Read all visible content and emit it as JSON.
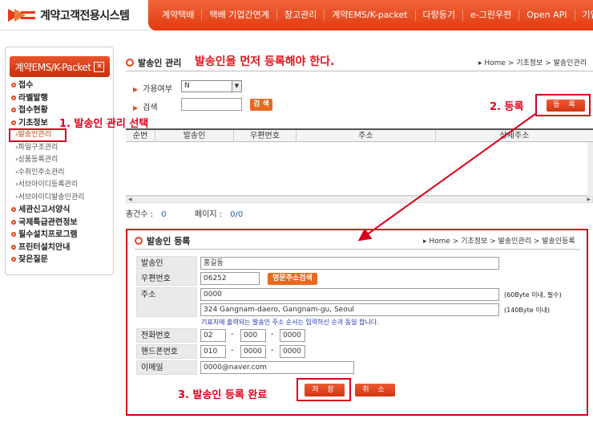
{
  "app": {
    "logo_text": "계약고객전용시스템"
  },
  "nav": [
    "계약택배",
    "택배 기업간연계",
    "창고관리",
    "계약EMS/K-packet",
    "다량등기",
    "e-그린우편",
    "Open API",
    "기업물류"
  ],
  "sidebar": {
    "title": "계약EMS/K-Packet",
    "title_icon": "close-box-icon",
    "items": [
      {
        "label": "접수",
        "type": "main"
      },
      {
        "label": "라벨발행",
        "type": "main"
      },
      {
        "label": "접수현황",
        "type": "main"
      },
      {
        "label": "기초정보",
        "type": "main"
      },
      {
        "label": "발송인관리",
        "type": "sub",
        "active": true
      },
      {
        "label": "파일구조관리",
        "type": "sub"
      },
      {
        "label": "상품등록관리",
        "type": "sub"
      },
      {
        "label": "수취인주소관리",
        "type": "sub"
      },
      {
        "label": "서브아이디등록관리",
        "type": "sub"
      },
      {
        "label": "서브아이디발송인관리",
        "type": "sub"
      },
      {
        "label": "세관신고서양식",
        "type": "main"
      },
      {
        "label": "국제특급관련정보",
        "type": "main"
      },
      {
        "label": "필수설치프로그램",
        "type": "main"
      },
      {
        "label": "프린터설치안내",
        "type": "main"
      },
      {
        "label": "잦은질문",
        "type": "main"
      }
    ]
  },
  "annotations": {
    "step1": "1. 발송인 관리 선택",
    "step2": "2. 등록",
    "step3": "3. 발송인 등록 완료",
    "warning": "발송인을 먼저 등록해야 한다."
  },
  "list_section": {
    "title": "발송인 관리",
    "breadcrumb": "▸ Home > 기초정보 > 발송인관리",
    "filter_use_label": "가용여부",
    "filter_use_value": "N",
    "filter_search_label": "검색",
    "search_value": "",
    "search_button": "검 색",
    "register_button": "등 록",
    "columns": [
      "순번",
      "발송인",
      "우편번호",
      "주소",
      "상세주소"
    ],
    "rows": [],
    "total_label": "총건수 :",
    "total_value": "0",
    "page_label": "페이지 :",
    "page_value": "0/0"
  },
  "form": {
    "title": "발송인 등록",
    "breadcrumb": "▸ Home > 기초정보 > 발송인관리 > 발송인등록",
    "sender_label": "발송인",
    "sender_value": "홍길동",
    "postcode_label": "우편번호",
    "postcode_value": "06252",
    "postcode_button": "영문주소검색",
    "address_label": "주소",
    "address_value": "0000",
    "address_hint": "(60Byte 이내, 필수)",
    "address_detail_value": "324 Gangnam-daero, Gangnam-gu, Seoul",
    "address_detail_hint": "(140Byte 이내)",
    "note": "기표지에 출력되는 발송인 주소 순서는 입력하신 순과 동일 합니다.",
    "phone_label": "전화번호",
    "phone": [
      "02",
      "000",
      "0000"
    ],
    "mobile_label": "핸드폰번호",
    "mobile": [
      "010",
      "0000",
      "0000"
    ],
    "email_label": "이메일",
    "email_value": "0000@naver.com",
    "save_button": "저 장",
    "cancel_button": "취 소"
  },
  "colors": {
    "accent": "#e23b10",
    "annotation_red": "#d9001b",
    "note_blue": "#1a34b0"
  }
}
